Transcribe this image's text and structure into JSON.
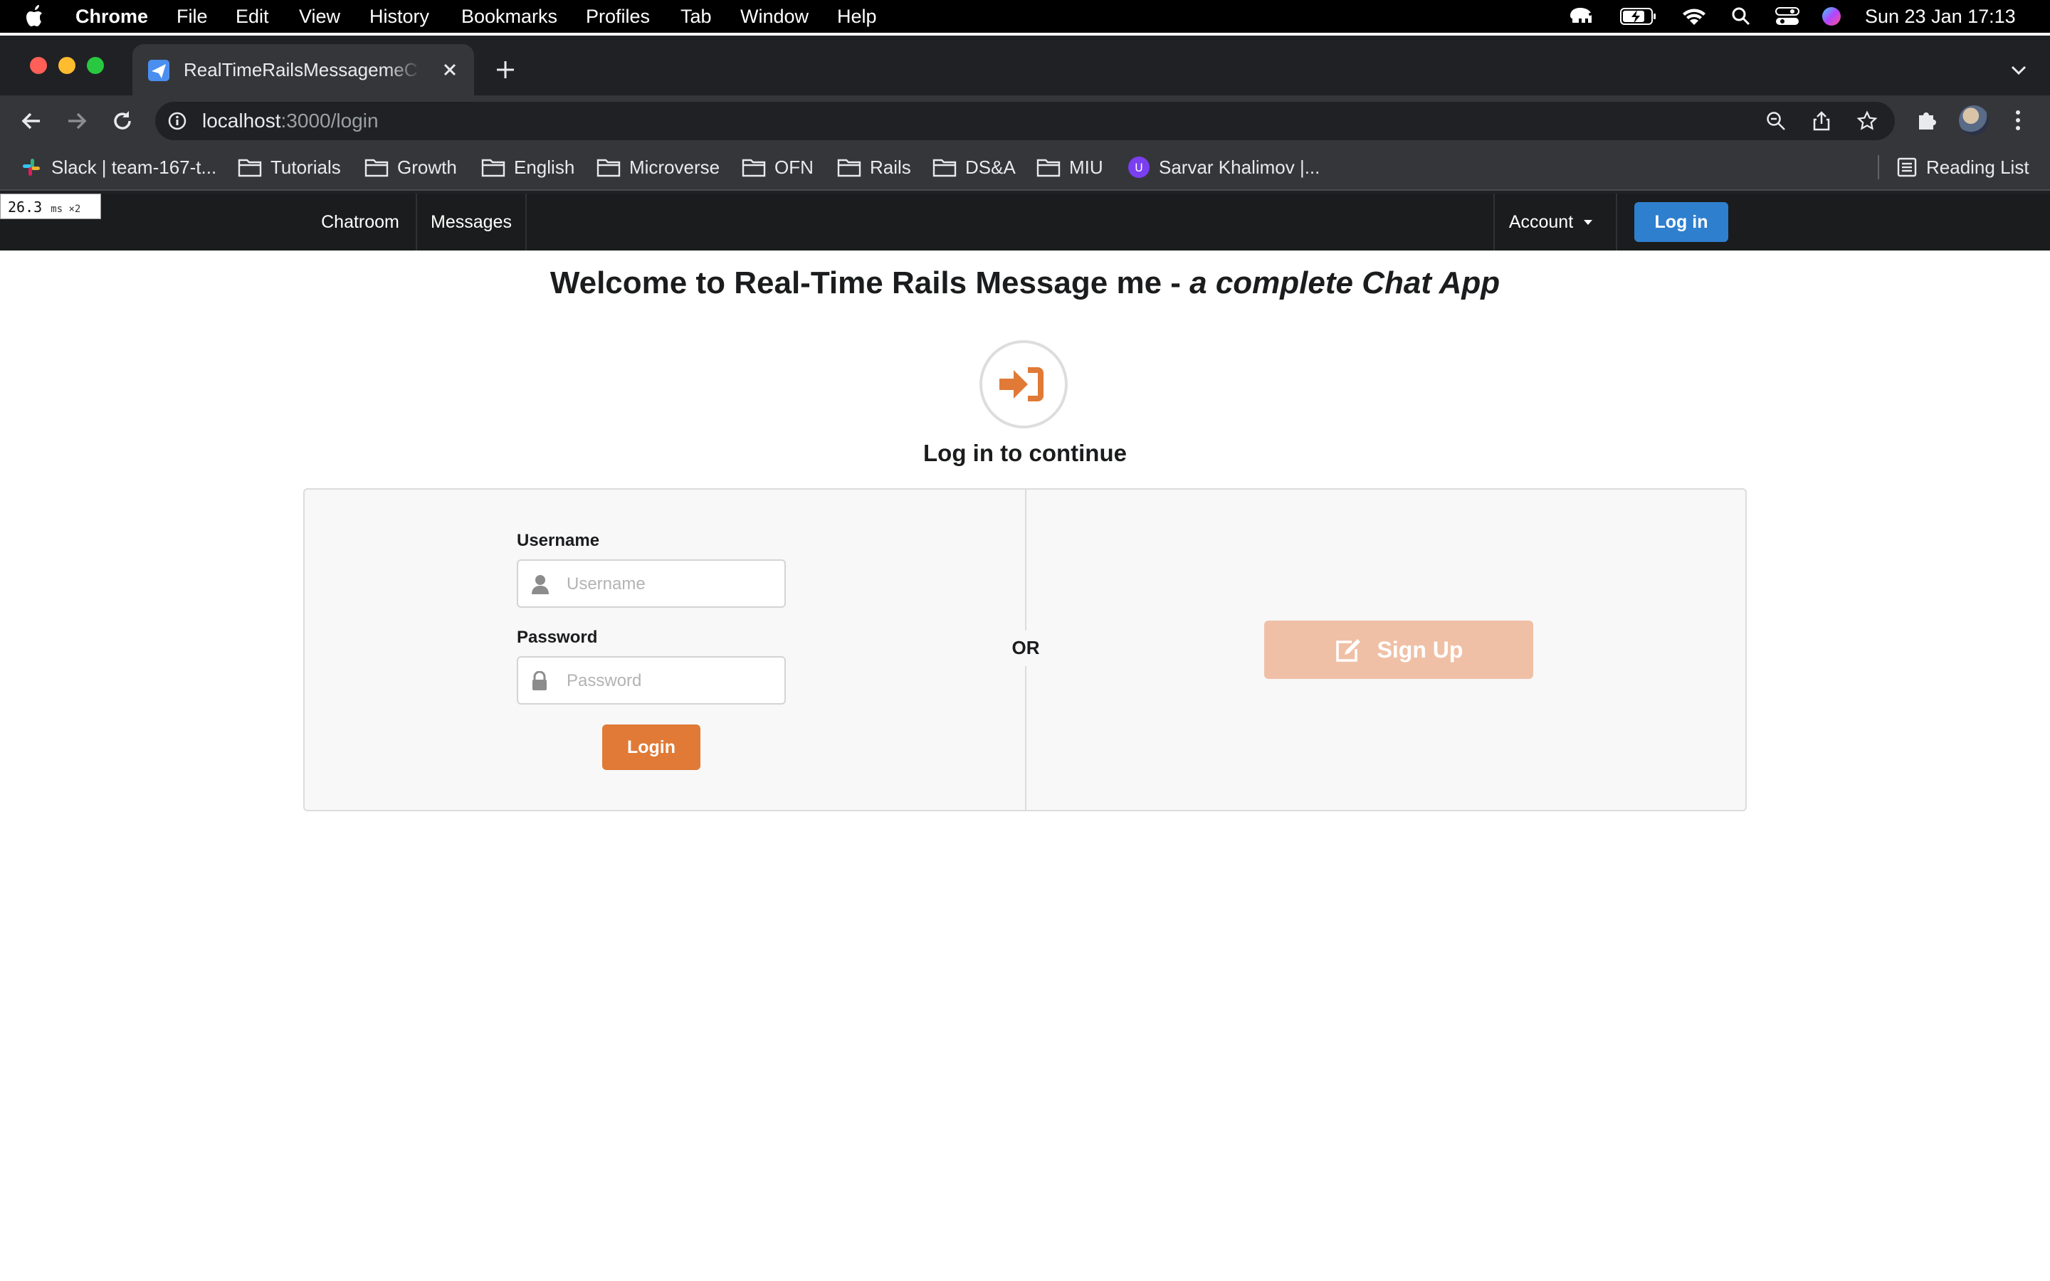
{
  "menubar": {
    "app": "Chrome",
    "items": [
      "File",
      "Edit",
      "View",
      "History",
      "Bookmarks",
      "Profiles",
      "Tab",
      "Window",
      "Help"
    ],
    "clock": "Sun 23 Jan  17:13"
  },
  "browser": {
    "tab_title": "RealTimeRailsMessagemeChatApp",
    "url_host": "localhost",
    "url_path": ":3000/login",
    "bookmarks": [
      "Slack | team-167-t...",
      "Tutorials",
      "Growth",
      "English",
      "Microverse",
      "OFN",
      "Rails",
      "DS&A",
      "MIU",
      "Sarvar Khalimov |..."
    ],
    "reading_list": "Reading List",
    "perf_value": "26.3",
    "perf_unit": "ms ×2"
  },
  "navbar": {
    "chatroom": "Chatroom",
    "messages": "Messages",
    "account": "Account",
    "login": "Log in"
  },
  "page": {
    "welcome_prefix": "Welcome to Real-Time Rails Message me - ",
    "welcome_emphasis": "a complete Chat App",
    "subtitle": "Log in to continue",
    "username_label": "Username",
    "username_placeholder": "Username",
    "password_label": "Password",
    "password_placeholder": "Password",
    "login_button": "Login",
    "or_text": "OR",
    "signup_button": "Sign Up"
  },
  "colors": {
    "accent_orange": "#e07a36",
    "signup_disabled": "#f0c0a6",
    "primary_blue": "#2f7fcf",
    "navbar_bg": "#1b1c1d"
  }
}
